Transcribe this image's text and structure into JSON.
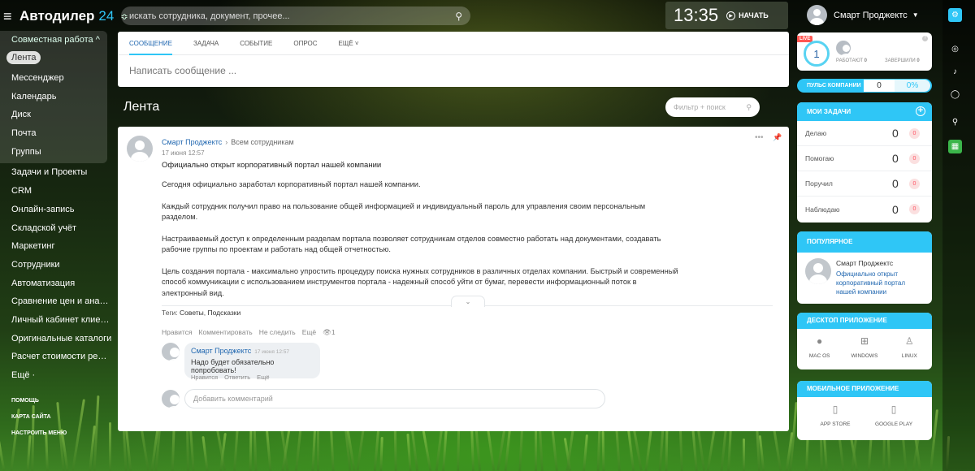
{
  "header": {
    "app_name": "Автодилер",
    "app_version": "24",
    "search_placeholder": "искать сотрудника, документ, прочее...",
    "clock_time": "13:35",
    "clock_start": "НАЧАТЬ",
    "user_name": "Смарт Проджектс"
  },
  "sidebar": {
    "group_title": "Совместная работа ^",
    "group_items": [
      "Лента",
      "Мессенджер",
      "Календарь",
      "Диск",
      "Почта",
      "Группы"
    ],
    "items": [
      "Задачи и Проекты",
      "CRM",
      "Онлайн-запись",
      "Складской учёт",
      "Маркетинг",
      "Сотрудники",
      "Автоматизация",
      "Сравнение цен и аналит...",
      "Личный кабинет клиента",
      "Оригинальные каталоги",
      "Расчет стоимости ремон...",
      "Ещё ·"
    ],
    "bottom_links": [
      "ПОМОЩЬ",
      "КАРТА САЙТА",
      "НАСТРОИТЬ МЕНЮ"
    ]
  },
  "composer": {
    "tabs": [
      "СООБЩЕНИЕ",
      "ЗАДАЧА",
      "СОБЫТИЕ",
      "ОПРОС",
      "ЕЩЁ ˅"
    ],
    "placeholder": "Написать сообщение ..."
  },
  "feed": {
    "title": "Лента",
    "filter_placeholder": "Фильтр + поиск"
  },
  "post": {
    "author": "Смарт Проджектс",
    "recipient": "Всем сотрудникам",
    "date": "17 июня 12:57",
    "title": "Официально открыт корпоративный портал нашей компании",
    "paragraphs": [
      "Сегодня официально заработал корпоративный портал нашей компании.",
      "Каждый сотрудник получил право на пользование общей информацией и индивидуальный пароль для управления своим персональным разделом.",
      "Настраиваемый доступ к определенным разделам портала позволяет сотрудникам отделов совместно работать над документами, создавать рабочие группы по проектам и работать над общей отчетностью.",
      "Цель создания портала - максимально упростить процедуру поиска нужных сотрудников в различных отделах компании. Быстрый и современный способ коммуникации с использованием инструментов портала - надежный способ уйти от бумаг, перевести информационный поток в электронный вид."
    ],
    "tags_label": "Теги:",
    "tags": [
      "Советы",
      "Подсказки"
    ],
    "actions": [
      "Нравится",
      "Комментировать",
      "Не следить",
      "Ещё"
    ],
    "views": "1",
    "comment": {
      "author": "Смарт Проджектс",
      "date": "17 июня 12:57",
      "text": "Надо будет обязательно попробовать!",
      "actions": [
        "Нравится",
        "Ответить",
        "Ещё"
      ]
    },
    "add_comment_placeholder": "Добавить комментарий"
  },
  "right": {
    "live_label": "LIVE",
    "meter_value": "1",
    "working_label": "РАБОТАЮТ",
    "working_count": "0",
    "finished_label": "ЗАВЕРШИЛИ",
    "finished_count": "0",
    "pulse_label": "ПУЛЬС КОМПАНИИ",
    "pulse_value": "0",
    "pulse_percent": "0%",
    "tasks_title": "МОИ ЗАДАЧИ",
    "tasks": [
      {
        "label": "Делаю",
        "count": "0",
        "badge": "0"
      },
      {
        "label": "Помогаю",
        "count": "0",
        "badge": "0"
      },
      {
        "label": "Поручил",
        "count": "0",
        "badge": "0"
      },
      {
        "label": "Наблюдаю",
        "count": "0",
        "badge": "0"
      }
    ],
    "popular_title": "ПОПУЛЯРНОЕ",
    "popular_author": "Смарт Проджектс",
    "popular_link": "Официально открыт корпоративный портал нашей компании",
    "desktop_title": "ДЕСКТОП ПРИЛОЖЕНИЕ",
    "desktop_apps": [
      "MAC OS",
      "WINDOWS",
      "LINUX"
    ],
    "mobile_title": "МОБИЛЬНОЕ ПРИЛОЖЕНИЕ",
    "mobile_apps": [
      "APP STORE",
      "GOOGLE PLAY"
    ]
  },
  "colors": {
    "accent": "#2fc6f6",
    "link": "#2067b0",
    "badge": "#ff5752",
    "clock_bg": "#5a6450",
    "strip_green": "#3bb54a"
  }
}
